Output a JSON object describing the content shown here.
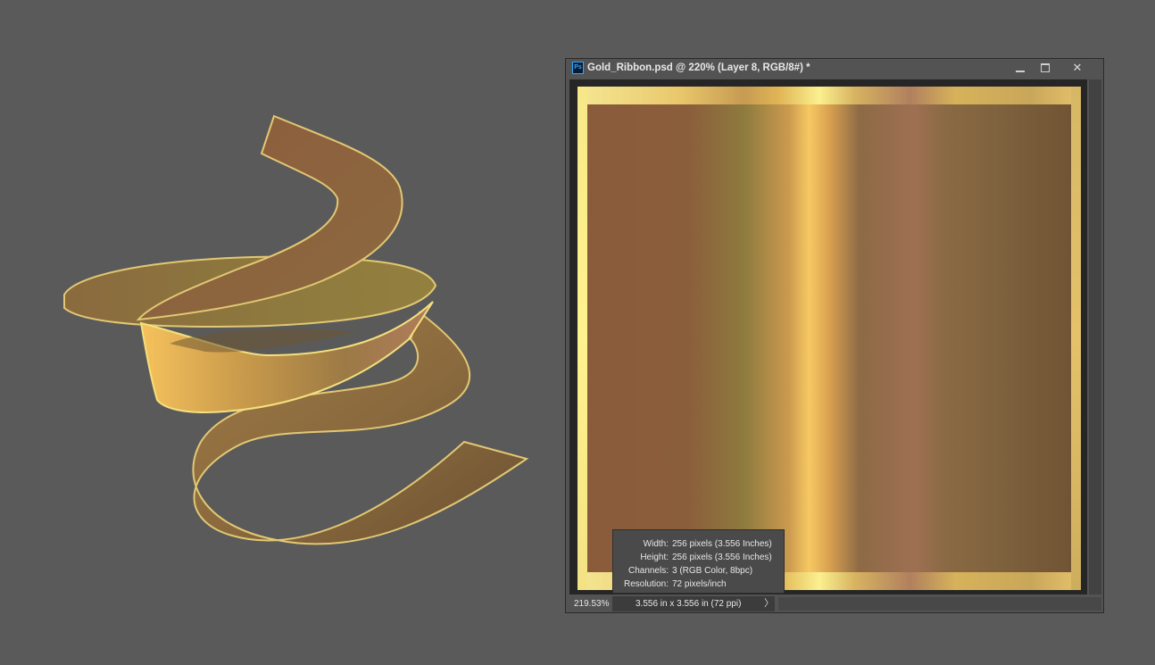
{
  "window": {
    "title": "Gold_Ribbon.psd @ 220% (Layer 8, RGB/8#) *",
    "app_icon": "photoshop-icon",
    "app_icon_text": "Ps",
    "close_glyph": "✕"
  },
  "status_bar": {
    "zoom": "219.53%",
    "document_size": "3.556 in x 3.556 in (72 ppi)",
    "arrow_glyph": "〉"
  },
  "doc_info": {
    "width_label": "Width:",
    "width_value": "256 pixels (3.556 Inches)",
    "height_label": "Height:",
    "height_value": "256 pixels (3.556 Inches)",
    "channels_label": "Channels:",
    "channels_value": "3 (RGB Color, 8bpc)",
    "resolution_label": "Resolution:",
    "resolution_value": "72 pixels/inch"
  },
  "colors": {
    "gold_light": "#f7c863",
    "gold_mid": "#8e7a3e",
    "bronze": "#8a5b3b",
    "pinkish_band": "#9e7052",
    "background": "#5a5a5a"
  }
}
